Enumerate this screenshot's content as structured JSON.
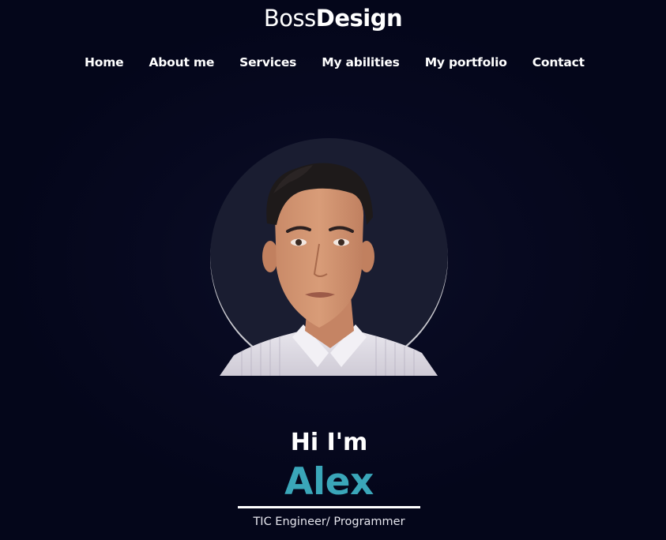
{
  "brand": {
    "light": "Boss",
    "bold": "Design"
  },
  "nav": {
    "items": [
      {
        "label": "Home"
      },
      {
        "label": "About me"
      },
      {
        "label": "Services"
      },
      {
        "label": "My abilities"
      },
      {
        "label": "My portfolio"
      },
      {
        "label": "Contact"
      }
    ]
  },
  "hero": {
    "greeting": "Hi I'm",
    "name": "Alex",
    "role": "TIC Engineer/ Programmer"
  },
  "colors": {
    "background": "#04061a",
    "accent": "#3aa6b9",
    "text": "#ffffff"
  }
}
